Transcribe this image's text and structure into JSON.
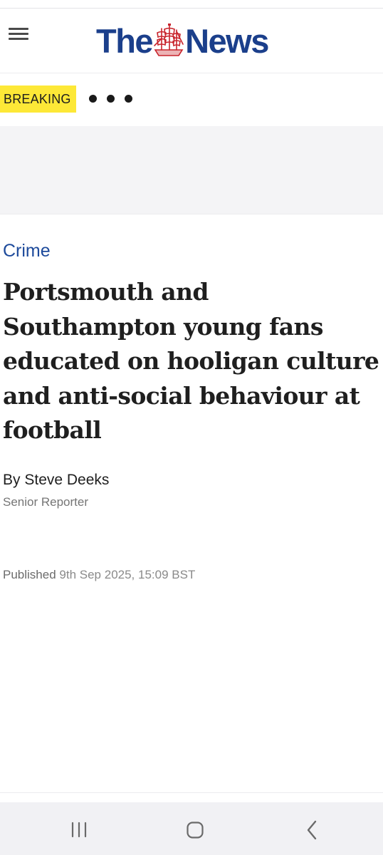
{
  "header": {
    "logo_left": "The",
    "logo_right": "News",
    "menu_icon": "hamburger-menu-icon",
    "brand_color": "#1b3f8b"
  },
  "breaking": {
    "label": "BREAKING",
    "badge_color": "#fde837",
    "loader_icon": "loading-dots-icon"
  },
  "article": {
    "category": "Crime",
    "category_color": "#1d4a9b",
    "headline": "Portsmouth and Southampton young fans educated on hooligan culture and anti-social behaviour at football",
    "byline_prefix": "By",
    "author": "Steve Deeks",
    "author_role": "Senior Reporter",
    "published_label": "Published",
    "published_date": "9th Sep 2025, 15:09 BST"
  },
  "system_nav": {
    "recents_icon": "recent-apps-icon",
    "home_icon": "home-icon",
    "back_icon": "back-icon"
  }
}
